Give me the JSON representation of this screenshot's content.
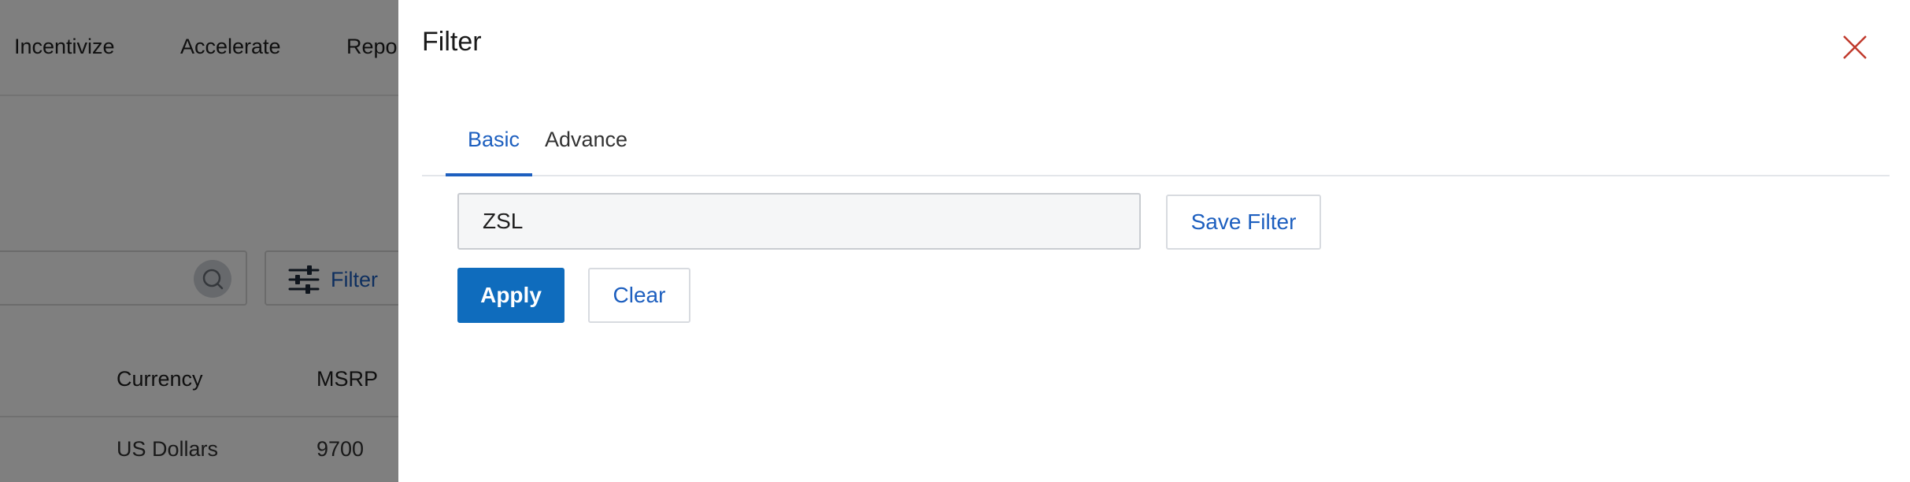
{
  "background": {
    "nav_items": [
      "Incentivize",
      "Accelerate",
      "Repor"
    ],
    "search": {
      "placeholder": ""
    },
    "filter_button_label": "Filter",
    "table": {
      "columns": [
        "Currency",
        "MSRP"
      ],
      "rows": [
        [
          "US Dollars",
          "9700"
        ]
      ]
    }
  },
  "filter_panel": {
    "title": "Filter",
    "tabs": [
      {
        "label": "Basic",
        "active": true
      },
      {
        "label": "Advance",
        "active": false
      }
    ],
    "input": {
      "value": "ZSL",
      "placeholder": ""
    },
    "buttons": {
      "save_filter": "Save Filter",
      "apply": "Apply",
      "clear": "Clear"
    }
  },
  "colors": {
    "accent": "#1d5fbf",
    "primary_button": "#0f6cbd",
    "close_icon": "#c0392b",
    "overlay": "rgba(0,0,0,0.5)"
  },
  "icons": [
    "search-icon",
    "sliders-icon",
    "close-icon"
  ]
}
